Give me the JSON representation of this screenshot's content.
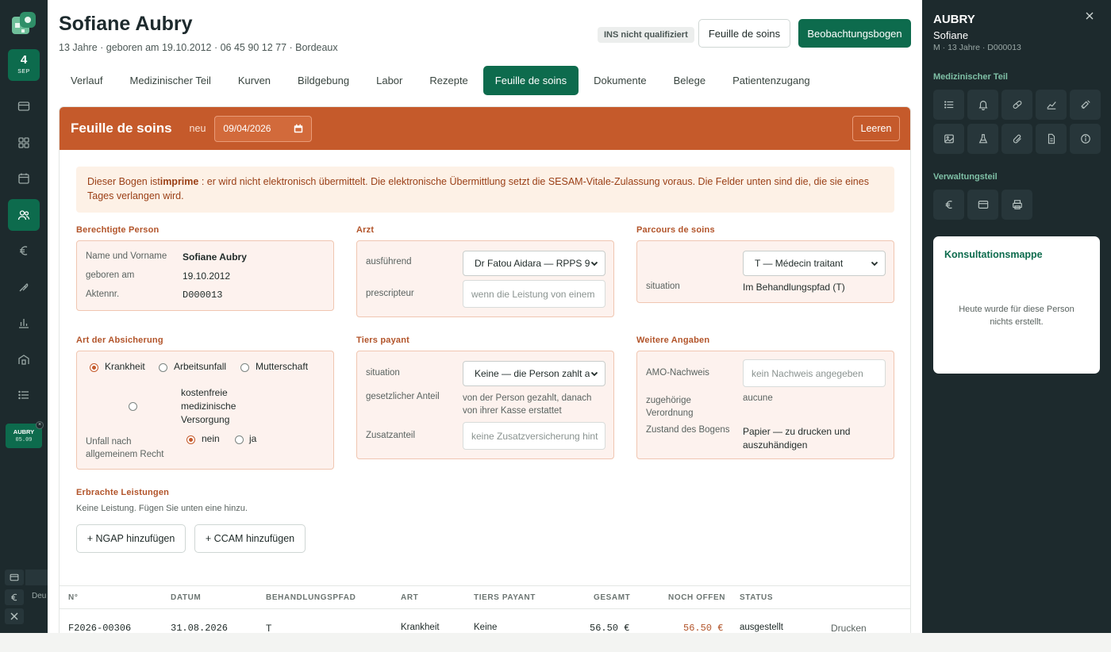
{
  "rail": {
    "date_day": "4",
    "date_month": "SEP",
    "patient_chip_name": "AUBRY",
    "patient_chip_date": "05.09",
    "lang": "Deu"
  },
  "header": {
    "patient_name": "Sofiane Aubry",
    "patient_meta": "13 Jahre · geboren am 19.10.2012 · 06 45 90 12 77 · Bordeaux",
    "ins_badge": "INS nicht qualifiziert",
    "btn_feuille": "Feuille de soins",
    "btn_beobachtung": "Beobachtungsbogen"
  },
  "tabs": [
    {
      "label": "Verlauf"
    },
    {
      "label": "Medizinischer Teil"
    },
    {
      "label": "Kurven"
    },
    {
      "label": "Bildgebung"
    },
    {
      "label": "Labor"
    },
    {
      "label": "Rezepte"
    },
    {
      "label": "Feuille de soins"
    },
    {
      "label": "Dokumente"
    },
    {
      "label": "Belege"
    },
    {
      "label": "Patientenzugang"
    }
  ],
  "form": {
    "title": "Feuille de soins",
    "neu": "neu",
    "date_value": "09/04/2026",
    "leeren": "Leeren",
    "notice_pre": "Dieser Bogen ist",
    "notice_bold": "imprime",
    "notice_post": " : er wird nicht elektronisch übermittelt. Die elektronische Übermittlung setzt die SESAM-Vitale-Zulassung voraus. Die Felder unten sind die, die sie eines Tages verlangen wird.",
    "berechtigte": {
      "title": "Berechtigte Person",
      "name_label": "Name und Vorname",
      "name_value": "Sofiane Aubry",
      "born_label": "geboren am",
      "born_value": "19.10.2012",
      "akten_label": "Aktennr.",
      "akten_value": "D000013"
    },
    "arzt": {
      "title": "Arzt",
      "ausf_label": "ausführend",
      "ausf_value": "Dr Fatou Aidara — RPPS 9",
      "presc_label": "prescripteur",
      "presc_placeholder": "wenn die Leistung von einem"
    },
    "parcours": {
      "title": "Parcours de soins",
      "select_value": "T — Médecin traitant",
      "situation_label": "situation",
      "situation_value": "Im Behandlungspfad (T)"
    },
    "absicherung": {
      "title": "Art der Absicherung",
      "opt1": "Krankheit",
      "opt2": "Arbeitsunfall",
      "opt3": "Mutterschaft",
      "opt4": "kostenfreie medizinische Versorgung",
      "unfall_label": "Unfall nach allgemeinem Recht",
      "nein": "nein",
      "ja": "ja"
    },
    "tiers": {
      "title": "Tiers payant",
      "situation_label": "situation",
      "situation_value": "Keine — die Person zahlt a",
      "gesetz_label": "gesetzlicher Anteil",
      "gesetz_value": "von der Person gezahlt, danach von ihrer Kasse erstattet",
      "zusatz_label": "Zusatzanteil",
      "zusatz_placeholder": "keine Zusatzversicherung hint"
    },
    "weitere": {
      "title": "Weitere Angaben",
      "amo_label": "AMO-Nachweis",
      "amo_placeholder": "kein Nachweis angegeben",
      "verord_label": "zugehörige Verordnung",
      "verord_value": "aucune",
      "zustand_label": "Zustand des Bogens",
      "zustand_value": "Papier — zu drucken und auszuhändigen"
    },
    "leistungen": {
      "title": "Erbrachte Leistungen",
      "empty": "Keine Leistung. Fügen Sie unten eine hinzu.",
      "btn_ngap": "+ NGAP hinzufügen",
      "btn_ccam": "+ CCAM hinzufügen"
    }
  },
  "table": {
    "headers": [
      "N°",
      "DATUM",
      "BEHANDLUNGSPFAD",
      "ART",
      "TIERS PAYANT",
      "GESAMT",
      "NOCH OFFEN",
      "STATUS"
    ],
    "rows": [
      {
        "nr": "F2026-00306",
        "datum": "31.08.2026",
        "pfad": "T",
        "art": "Krankheit",
        "tiers": "Keine",
        "gesamt": "56.50 €",
        "offen": "56.50 €",
        "status": "ausgestellt",
        "action": "Drucken"
      }
    ]
  },
  "rpanel": {
    "name": "AUBRY",
    "first": "Sofiane",
    "meta": "M · 13 Jahre · D000013",
    "sec_med": "Medizinischer Teil",
    "sec_verw": "Verwaltungsteil",
    "mappe_title": "Konsultationsmappe",
    "mappe_empty": "Heute wurde für diese Person nichts erstellt."
  },
  "colors": {
    "brand_green": "#0d6b4d",
    "form_orange": "#c55a2b",
    "dark_panel": "#1d2a2d"
  }
}
